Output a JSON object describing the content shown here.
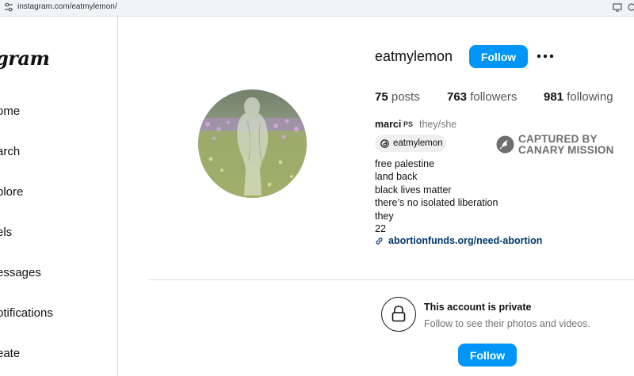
{
  "browser": {
    "url": "instagram.com/eatmylemon/",
    "left_icon": "tune-icon",
    "right_icons": [
      "cast-icon",
      "extensions-icon"
    ]
  },
  "sidebar": {
    "logo": "gram",
    "items": [
      {
        "label": "ome",
        "icon": "home-icon"
      },
      {
        "label": "arch",
        "icon": "search-icon"
      },
      {
        "label": "plore",
        "icon": "explore-icon"
      },
      {
        "label": "els",
        "icon": "reels-icon"
      },
      {
        "label": "essages",
        "icon": "messages-icon"
      },
      {
        "label": "otifications",
        "icon": "notifications-icon"
      },
      {
        "label": "eate",
        "icon": "create-icon"
      }
    ]
  },
  "profile": {
    "username": "eatmylemon",
    "follow_label": "Follow",
    "more_icon": "more-options-icon",
    "stats": {
      "posts_count": "75",
      "posts_label": "posts",
      "followers_count": "763",
      "followers_label": "followers",
      "following_count": "981",
      "following_label": "following"
    },
    "full_name": "marci",
    "badge": "PS",
    "pronouns": "they/she",
    "threads_handle": "eatmylemon",
    "bio_lines": [
      "free palestine",
      "land back",
      "black lives matter",
      "there’s no isolated liberation",
      "they",
      "22"
    ],
    "link": "abortionfunds.org/need-abortion"
  },
  "overlay": {
    "line1": "CAPTURED BY",
    "line2": "CANARY MISSION",
    "icon": "canary-bird-icon"
  },
  "private": {
    "title": "This account is private",
    "subtitle": "Follow to see their photos and videos.",
    "follow_label": "Follow",
    "icon": "lock-icon"
  },
  "colors": {
    "accent": "#0095f6",
    "link": "#00376b",
    "muted": "#737373",
    "watermark": "#6e6e6e"
  }
}
